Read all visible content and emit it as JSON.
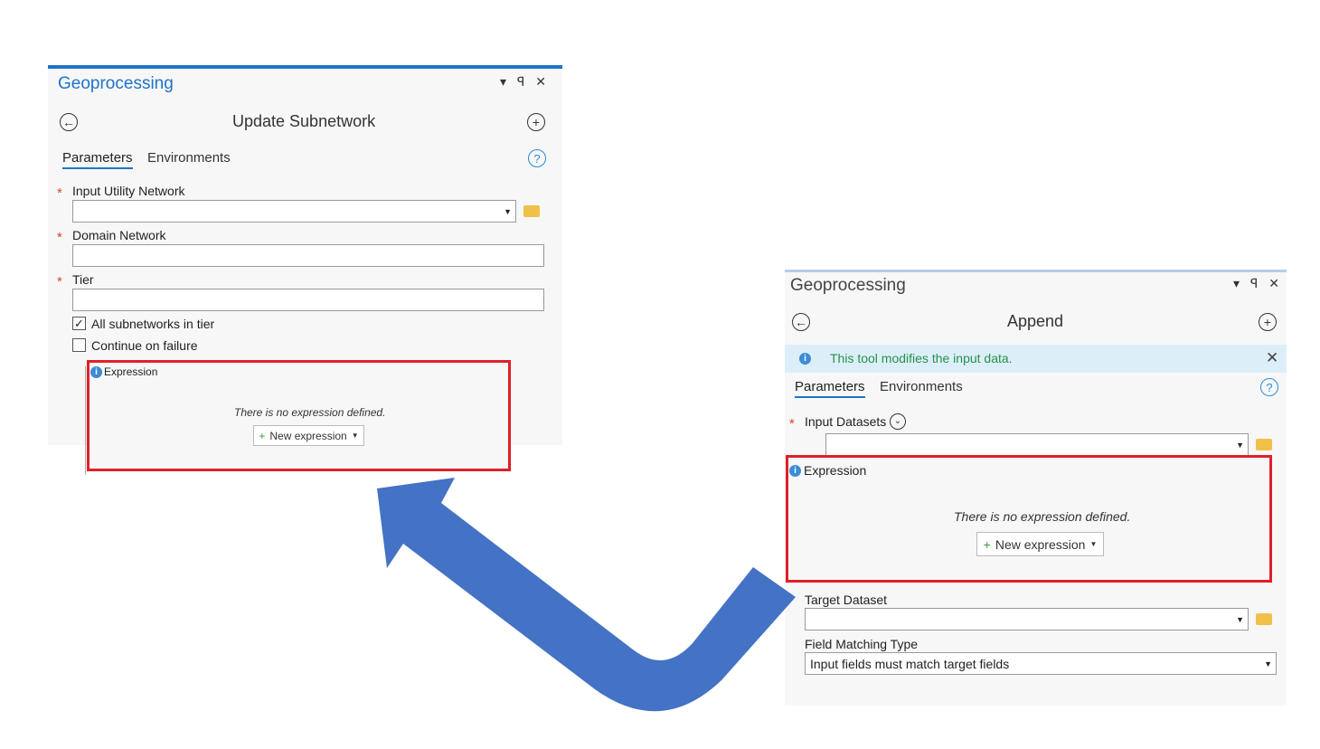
{
  "left_pane": {
    "title": "Geoprocessing",
    "controls": "▾ ꟼ ✕",
    "tool_title": "Update Subnetwork",
    "tabs": [
      "Parameters",
      "Environments"
    ],
    "params": [
      {
        "label": "Input Utility Network",
        "required": true,
        "type": "dropdown"
      },
      {
        "label": "Domain Network",
        "required": true,
        "type": "text"
      },
      {
        "label": "Tier",
        "required": true,
        "type": "text"
      }
    ],
    "checkboxes": [
      {
        "label": "All subnetworks in tier",
        "checked": true
      },
      {
        "label": "Continue on failure",
        "checked": false
      }
    ],
    "expression": {
      "label": "Expression",
      "empty_text": "There is no expression defined.",
      "button": "New expression"
    }
  },
  "right_pane": {
    "title": "Geoprocessing",
    "controls": "▾ ꟼ ✕",
    "tool_title": "Append",
    "banner": "This tool modifies the input data.",
    "tabs": [
      "Parameters",
      "Environments"
    ],
    "input_datasets_label": "Input Datasets",
    "expression": {
      "label": "Expression",
      "empty_text": "There is no expression defined.",
      "button": "New expression"
    },
    "target_dataset_label": "Target Dataset",
    "field_matching_label": "Field Matching Type",
    "field_matching_value": "Input fields must match target fields"
  },
  "colors": {
    "accent": "#1f73c9",
    "highlight": "#e0202a",
    "arrow": "#4472c4",
    "folder": "#f0c04a"
  },
  "icons": {
    "back": "back-arrow-icon",
    "add": "add-circle-icon",
    "help": "help-icon",
    "info": "info-icon",
    "folder": "folder-icon",
    "dropdown": "dropdown-arrow-icon"
  }
}
